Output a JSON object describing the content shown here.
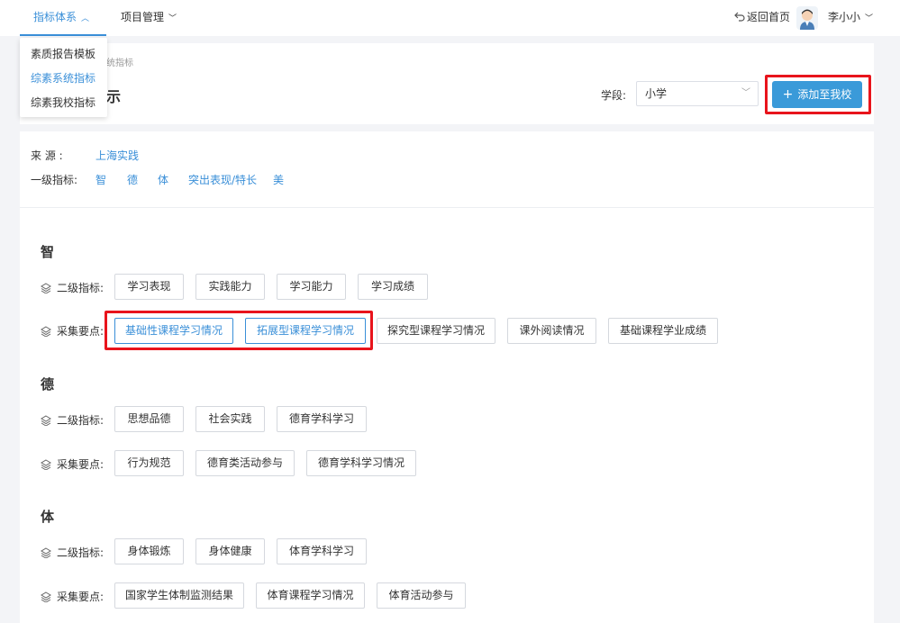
{
  "nav": {
    "items": [
      {
        "label": "指标体系",
        "active": true
      },
      {
        "label": "项目管理",
        "active": false
      }
    ],
    "back_home": "返回首页",
    "user_name": "李小小"
  },
  "dropdown": {
    "items": [
      "素质报告模板",
      "综素系统指标",
      "综素我校指标"
    ],
    "selected": "综素系统指标"
  },
  "header": {
    "breadcrumb": "统指标",
    "title": "示",
    "grade_label": "学段:",
    "grade_value": "小学",
    "add_button": "添加至我校"
  },
  "filters": {
    "source_label": "来  源  :",
    "source_value": "上海实践",
    "level1_label": "一级指标:",
    "level1_options": [
      "智",
      "德",
      "体",
      "突出表现/特长",
      "美"
    ]
  },
  "sections": [
    {
      "title": "智",
      "level2_label": "二级指标:",
      "level2_tags": [
        "学习表现",
        "实践能力",
        "学习能力",
        "学习成绩"
      ],
      "points_label": "采集要点:",
      "points_tags": [
        "基础性课程学习情况",
        "拓展型课程学习情况",
        "探究型课程学习情况",
        "课外阅读情况",
        "基础课程学业成绩"
      ],
      "points_selected": [
        "基础性课程学习情况",
        "拓展型课程学习情况"
      ]
    },
    {
      "title": "德",
      "level2_label": "二级指标:",
      "level2_tags": [
        "思想品德",
        "社会实践",
        "德育学科学习"
      ],
      "points_label": "采集要点:",
      "points_tags": [
        "行为规范",
        "德育类活动参与",
        "德育学科学习情况"
      ]
    },
    {
      "title": "体",
      "level2_label": "二级指标:",
      "level2_tags": [
        "身体锻炼",
        "身体健康",
        "体育学科学习"
      ],
      "points_label": "采集要点:",
      "points_tags": [
        "国家学生体制监测结果",
        "体育课程学习情况",
        "体育活动参与"
      ]
    }
  ],
  "colors": {
    "accent": "#3a8fd8",
    "button": "#3a9ad9",
    "highlight": "#e8141c"
  },
  "icons": [
    "chevron-up-icon",
    "chevron-down-icon",
    "back-arrow-icon",
    "avatar",
    "layers-icon",
    "plus-icon"
  ]
}
